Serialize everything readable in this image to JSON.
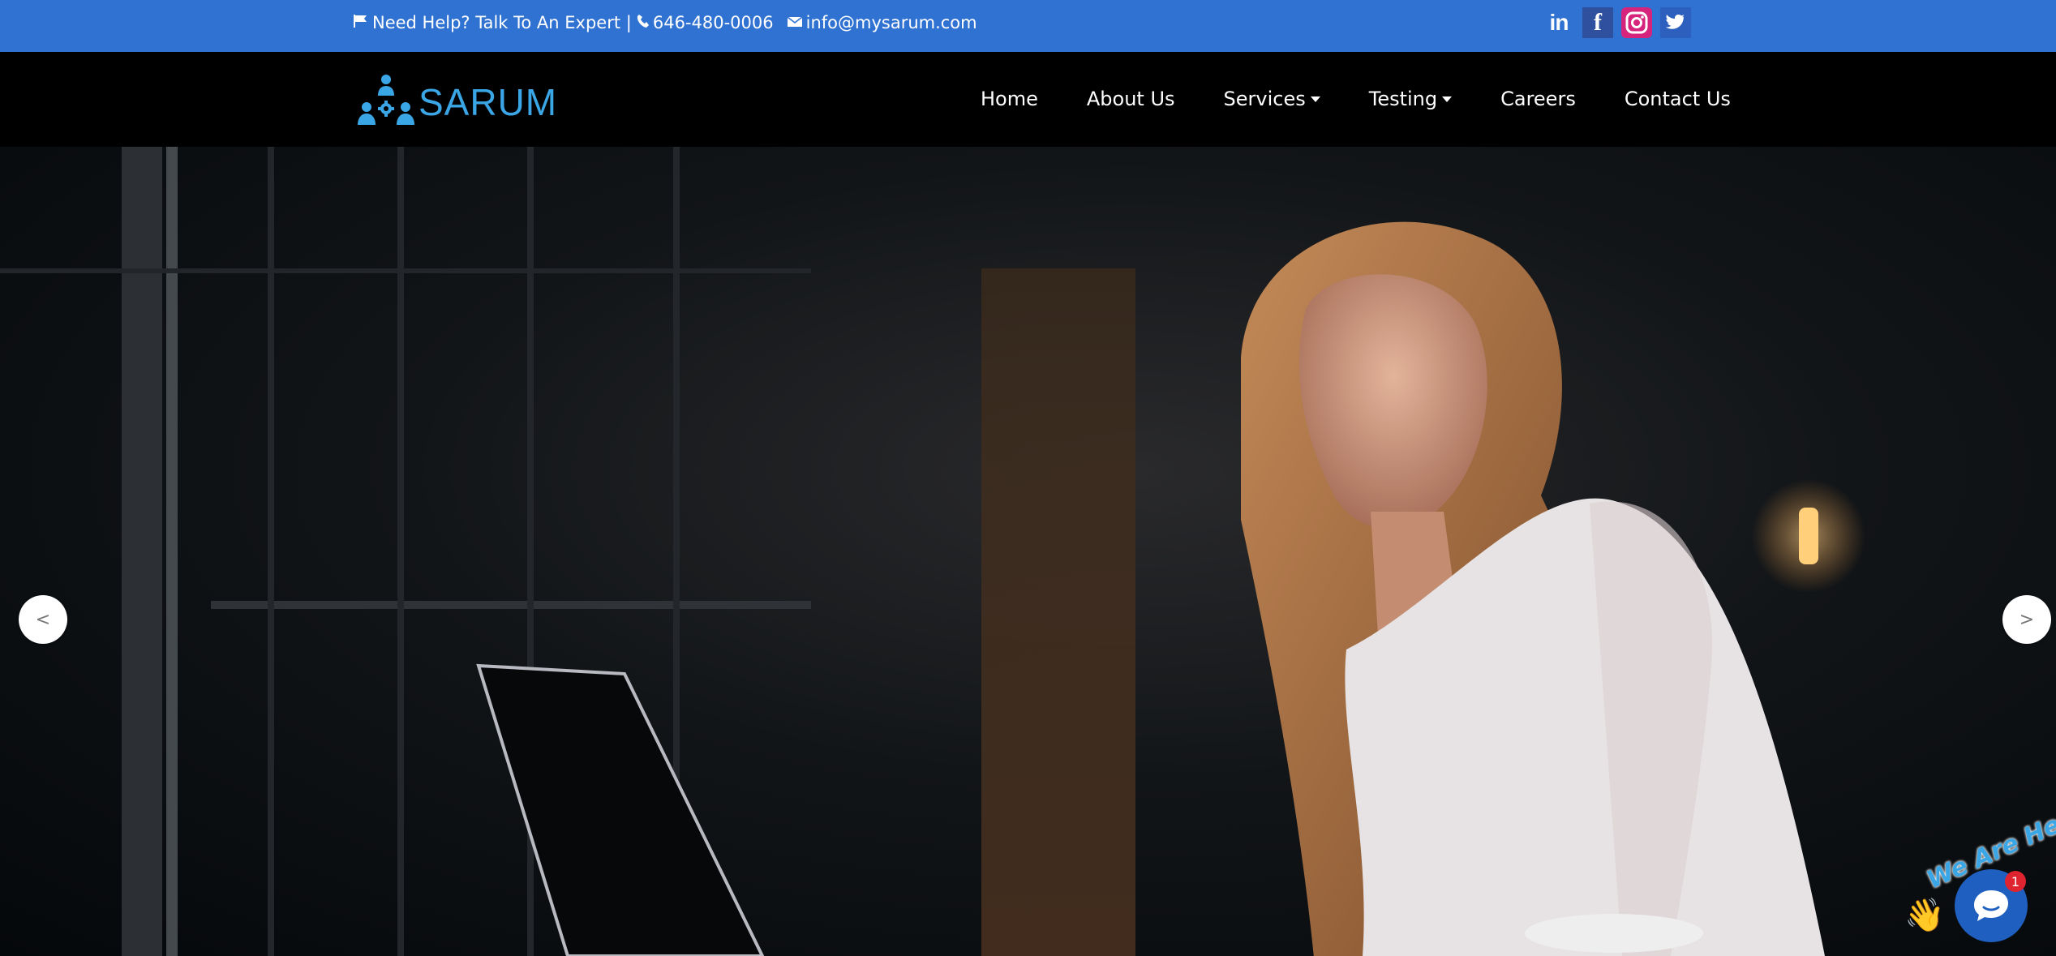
{
  "topbar": {
    "help_text": "Need Help? Talk To An Expert |",
    "phone": "646-480-0006",
    "email": "info@mysarum.com",
    "social": {
      "linkedin_label": "in",
      "facebook_label": "f",
      "twitter_label": "t"
    }
  },
  "brand": {
    "name": "SARUM"
  },
  "nav": {
    "items": [
      {
        "label": "Home"
      },
      {
        "label": "About Us"
      },
      {
        "label": "Services"
      },
      {
        "label": "Testing"
      },
      {
        "label": "Careers"
      },
      {
        "label": "Contact Us"
      }
    ]
  },
  "hero": {
    "prev_label": "<",
    "next_label": ">"
  },
  "chat": {
    "banner": "We Are Here!",
    "unread_count": "1"
  },
  "colors": {
    "topbar": "#3072d2",
    "brand": "#3aa6e6",
    "nav_bg": "#000000",
    "chat": "#1f5fbf"
  }
}
